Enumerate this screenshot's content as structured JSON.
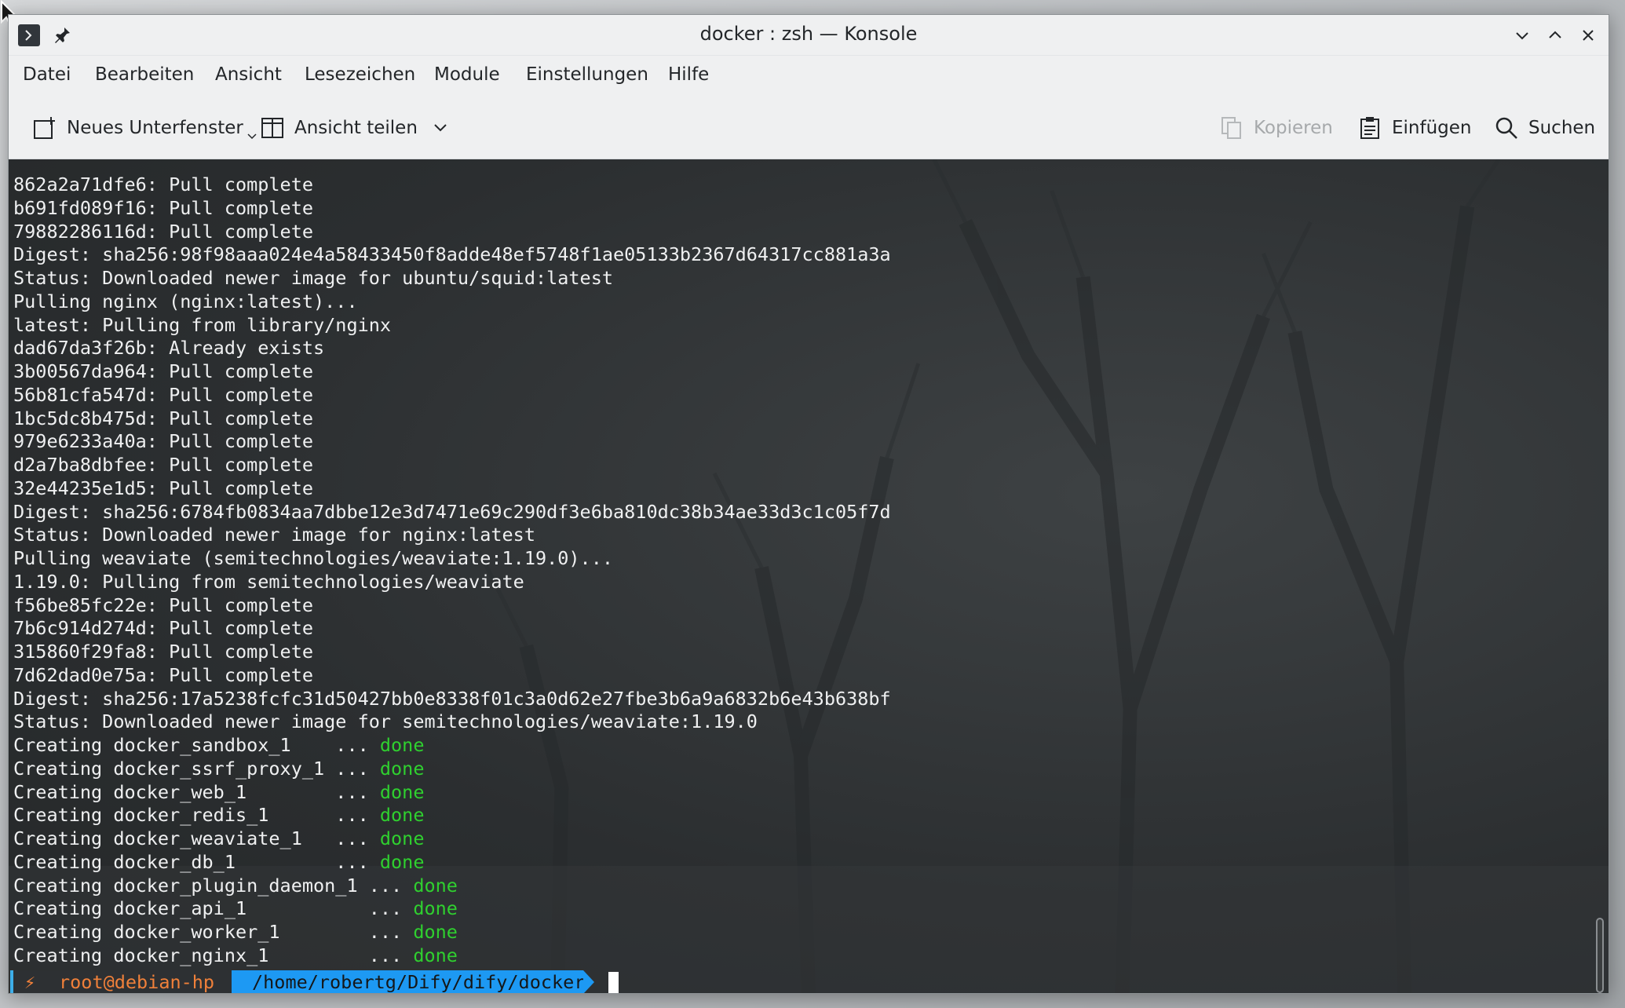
{
  "window": {
    "title": "docker : zsh — Konsole"
  },
  "menubar": {
    "items": [
      "Datei",
      "Bearbeiten",
      "Ansicht",
      "Lesezeichen",
      "Module",
      "Einstellungen",
      "Hilfe"
    ]
  },
  "toolbar": {
    "new_tab": "Neues Unterfenster",
    "split_view": "Ansicht teilen",
    "copy": "Kopieren",
    "paste": "Einfügen",
    "find": "Suchen"
  },
  "terminal": {
    "lines": [
      {
        "text": "862a2a71dfe6: Pull complete",
        "done": ""
      },
      {
        "text": "b691fd089f16: Pull complete",
        "done": ""
      },
      {
        "text": "79882286116d: Pull complete",
        "done": ""
      },
      {
        "text": "Digest: sha256:98f98aaa024e4a58433450f8adde48ef5748f1ae05133b2367d64317cc881a3a",
        "done": ""
      },
      {
        "text": "Status: Downloaded newer image for ubuntu/squid:latest",
        "done": ""
      },
      {
        "text": "Pulling nginx (nginx:latest)...",
        "done": ""
      },
      {
        "text": "latest: Pulling from library/nginx",
        "done": ""
      },
      {
        "text": "dad67da3f26b: Already exists",
        "done": ""
      },
      {
        "text": "3b00567da964: Pull complete",
        "done": ""
      },
      {
        "text": "56b81cfa547d: Pull complete",
        "done": ""
      },
      {
        "text": "1bc5dc8b475d: Pull complete",
        "done": ""
      },
      {
        "text": "979e6233a40a: Pull complete",
        "done": ""
      },
      {
        "text": "d2a7ba8dbfee: Pull complete",
        "done": ""
      },
      {
        "text": "32e44235e1d5: Pull complete",
        "done": ""
      },
      {
        "text": "Digest: sha256:6784fb0834aa7dbbe12e3d7471e69c290df3e6ba810dc38b34ae33d3c1c05f7d",
        "done": ""
      },
      {
        "text": "Status: Downloaded newer image for nginx:latest",
        "done": ""
      },
      {
        "text": "Pulling weaviate (semitechnologies/weaviate:1.19.0)...",
        "done": ""
      },
      {
        "text": "1.19.0: Pulling from semitechnologies/weaviate",
        "done": ""
      },
      {
        "text": "f56be85fc22e: Pull complete",
        "done": ""
      },
      {
        "text": "7b6c914d274d: Pull complete",
        "done": ""
      },
      {
        "text": "315860f29fa8: Pull complete",
        "done": ""
      },
      {
        "text": "7d62dad0e75a: Pull complete",
        "done": ""
      },
      {
        "text": "Digest: sha256:17a5238fcfc31d50427bb0e8338f01c3a0d62e27fbe3b6a9a6832b6e43b638bf",
        "done": ""
      },
      {
        "text": "Status: Downloaded newer image for semitechnologies/weaviate:1.19.0",
        "done": ""
      },
      {
        "text": "Creating docker_sandbox_1    ... ",
        "done": "done"
      },
      {
        "text": "Creating docker_ssrf_proxy_1 ... ",
        "done": "done"
      },
      {
        "text": "Creating docker_web_1        ... ",
        "done": "done"
      },
      {
        "text": "Creating docker_redis_1      ... ",
        "done": "done"
      },
      {
        "text": "Creating docker_weaviate_1   ... ",
        "done": "done"
      },
      {
        "text": "Creating docker_db_1         ... ",
        "done": "done"
      },
      {
        "text": "Creating docker_plugin_daemon_1 ... ",
        "done": "done"
      },
      {
        "text": "Creating docker_api_1           ... ",
        "done": "done"
      },
      {
        "text": "Creating docker_worker_1        ... ",
        "done": "done"
      },
      {
        "text": "Creating docker_nginx_1         ... ",
        "done": "done"
      }
    ],
    "prompt": {
      "symbol": "⚡",
      "user_host": "root@debian-hp",
      "path": "/home/robertg/Dify/dify/docker"
    }
  },
  "colors": {
    "done": "#2fd02f",
    "prompt_user": "#f0803a",
    "prompt_path_bg": "#1d99f3"
  }
}
